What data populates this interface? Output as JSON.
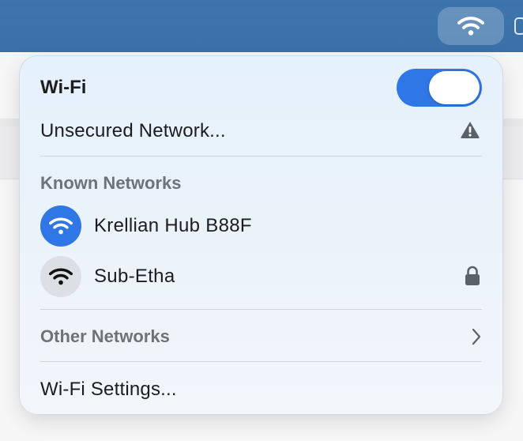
{
  "menubar": {
    "wifi_icon": "wifi-icon"
  },
  "panel": {
    "title": "Wi-Fi",
    "toggle_state": "on",
    "accent_color": "#2f76e7",
    "unsecured_label": "Unsecured Network...",
    "known_header": "Known Networks",
    "networks": [
      {
        "name": "Krellian Hub B88F",
        "connected": true,
        "icon": "wifi-icon"
      },
      {
        "name": "Sub-Etha",
        "connected": false,
        "icon": "wifi-icon",
        "secured": true,
        "lock_icon": "lock-icon"
      }
    ],
    "other_networks_label": "Other Networks",
    "settings_label": "Wi-Fi Settings..."
  }
}
